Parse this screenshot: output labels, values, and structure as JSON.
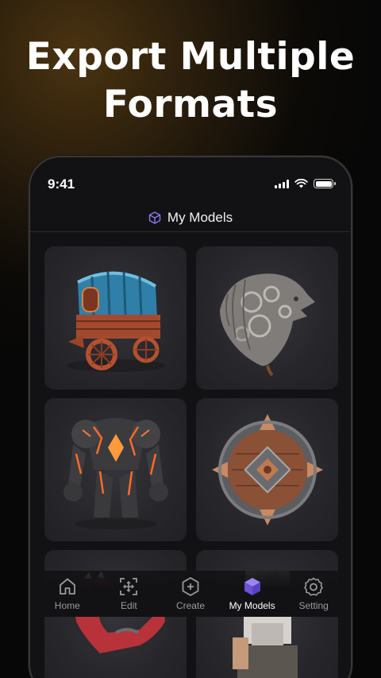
{
  "promo": {
    "headline_line1": "Export Multiple",
    "headline_line2": "Formats"
  },
  "status_bar": {
    "time": "9:41"
  },
  "header": {
    "title": "My Models",
    "icon": "cube-icon"
  },
  "models": [
    {
      "name": "wagon",
      "icon": "wagon-model"
    },
    {
      "name": "dragon-head",
      "icon": "dragon-head-model"
    },
    {
      "name": "lava-golem",
      "icon": "golem-model"
    },
    {
      "name": "shield",
      "icon": "shield-model"
    },
    {
      "name": "red-dinosaur",
      "icon": "dinosaur-model"
    },
    {
      "name": "voxel-dwarf",
      "icon": "voxel-dwarf-model"
    }
  ],
  "tabbar": {
    "items": [
      {
        "label": "Home",
        "icon": "home-icon",
        "active": false
      },
      {
        "label": "Edit",
        "icon": "edit-icon",
        "active": false
      },
      {
        "label": "Create",
        "icon": "create-icon",
        "active": false
      },
      {
        "label": "My Models",
        "icon": "cube-icon",
        "active": true
      },
      {
        "label": "Setting",
        "icon": "gear-icon",
        "active": false
      }
    ]
  },
  "colors": {
    "accent": "#7b5ce6",
    "background": "#121214",
    "card": "#2a2a2f"
  }
}
